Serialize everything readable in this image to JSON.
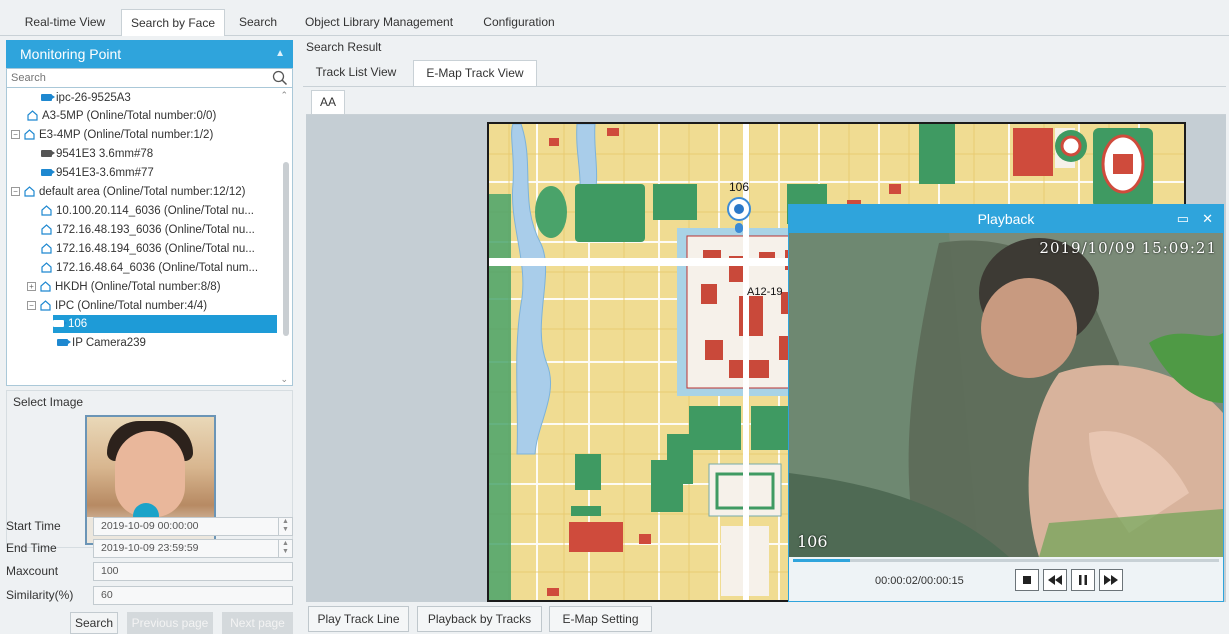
{
  "top_tabs": [
    {
      "label": "Real-time View"
    },
    {
      "label": "Search by Face"
    },
    {
      "label": "Search"
    },
    {
      "label": "Object Library Management"
    },
    {
      "label": "Configuration"
    }
  ],
  "left": {
    "header": "Monitoring Point",
    "search_placeholder": "Search",
    "tree": [
      {
        "label": "ipc-26-9525A3"
      },
      {
        "label": "A3-5MP (Online/Total number:0/0)"
      },
      {
        "label": "E3-4MP (Online/Total number:1/2)"
      },
      {
        "label": "9541E3 3.6mm#78"
      },
      {
        "label": "9541E3-3.6mm#77"
      },
      {
        "label": "default area (Online/Total number:12/12)"
      },
      {
        "label": "10.100.20.114_6036 (Online/Total nu..."
      },
      {
        "label": "172.16.48.193_6036 (Online/Total nu..."
      },
      {
        "label": "172.16.48.194_6036 (Online/Total nu..."
      },
      {
        "label": "172.16.48.64_6036 (Online/Total num..."
      },
      {
        "label": "HKDH (Online/Total number:8/8)"
      },
      {
        "label": "IPC (Online/Total number:4/4)"
      },
      {
        "label": "106"
      },
      {
        "label": "IP Camera239"
      }
    ],
    "select_image_label": "Select Image",
    "form": {
      "start_time_label": "Start Time",
      "start_time": "2019-10-09 00:00:00",
      "end_time_label": "End Time",
      "end_time": "2019-10-09 23:59:59",
      "maxcount_label": "Maxcount",
      "maxcount": "100",
      "similarity_label": "Similarity(%)",
      "similarity": "60"
    },
    "buttons": {
      "search": "Search",
      "previous": "Previous page",
      "next": "Next page"
    }
  },
  "right": {
    "search_result_label": "Search Result",
    "tabs": [
      {
        "label": "Track List View"
      },
      {
        "label": "E-Map Track View"
      }
    ],
    "map_tab": "AA",
    "map_labels": {
      "marker_106": "106",
      "marker_a12": "A12-19"
    },
    "bottom_buttons": {
      "play_track": "Play Track Line",
      "playback_tracks": "Playback by Tracks",
      "emap_setting": "E-Map Setting"
    }
  },
  "playback": {
    "title": "Playback",
    "timestamp": "2019/10/09  15:09:21",
    "channel": "106",
    "time": "00:00:02/00:00:15",
    "progress": 0.133
  },
  "colors": {
    "accent": "#2fa4dc",
    "selected": "#1e9bd7"
  }
}
